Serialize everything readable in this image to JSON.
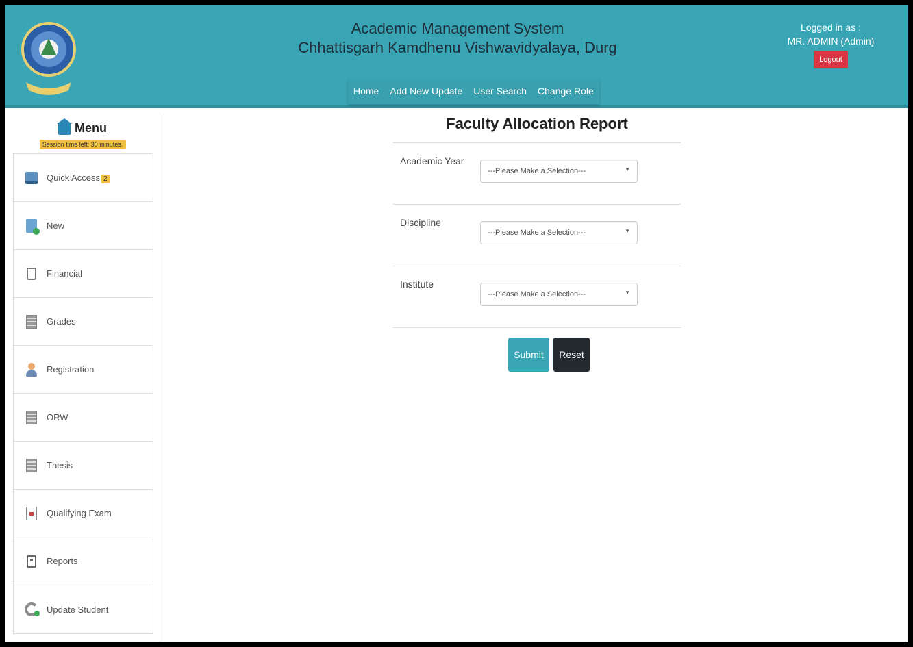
{
  "header": {
    "title_line1": "Academic Management System",
    "title_line2": "Chhattisgarh Kamdhenu Vishwavidyalaya, Durg",
    "nav": [
      "Home",
      "Add New Update",
      "User Search",
      "Change Role"
    ],
    "login_label": "Logged in as :",
    "login_user": "MR. ADMIN (Admin)",
    "logout_label": "Logout"
  },
  "sidebar": {
    "menu_title": "Menu",
    "session": "Session time left: 30 minutes.",
    "items": [
      {
        "label": "Quick Access",
        "icon": "monitor-icon",
        "badge": "2"
      },
      {
        "label": "New",
        "icon": "new-document-icon"
      },
      {
        "label": "Financial",
        "icon": "money-bag-icon"
      },
      {
        "label": "Grades",
        "icon": "grid-icon"
      },
      {
        "label": "Registration",
        "icon": "person-icon"
      },
      {
        "label": "ORW",
        "icon": "grid-icon"
      },
      {
        "label": "Thesis",
        "icon": "grid-icon"
      },
      {
        "label": "Qualifying Exam",
        "icon": "document-icon"
      },
      {
        "label": "Reports",
        "icon": "report-icon"
      },
      {
        "label": "Update Student",
        "icon": "cycle-icon"
      }
    ]
  },
  "main": {
    "title": "Faculty Allocation Report",
    "fields": [
      {
        "label": "Academic Year",
        "value": "---Please Make a Selection---"
      },
      {
        "label": "Discipline",
        "value": "---Please Make a Selection---"
      },
      {
        "label": "Institute",
        "value": "---Please Make a Selection---"
      }
    ],
    "submit_label": "Submit",
    "reset_label": "Reset"
  },
  "colors": {
    "header_bg": "#3aa5b5",
    "logout_bg": "#dc3545",
    "reset_bg": "#232a30",
    "badge_bg": "#f0c040"
  }
}
